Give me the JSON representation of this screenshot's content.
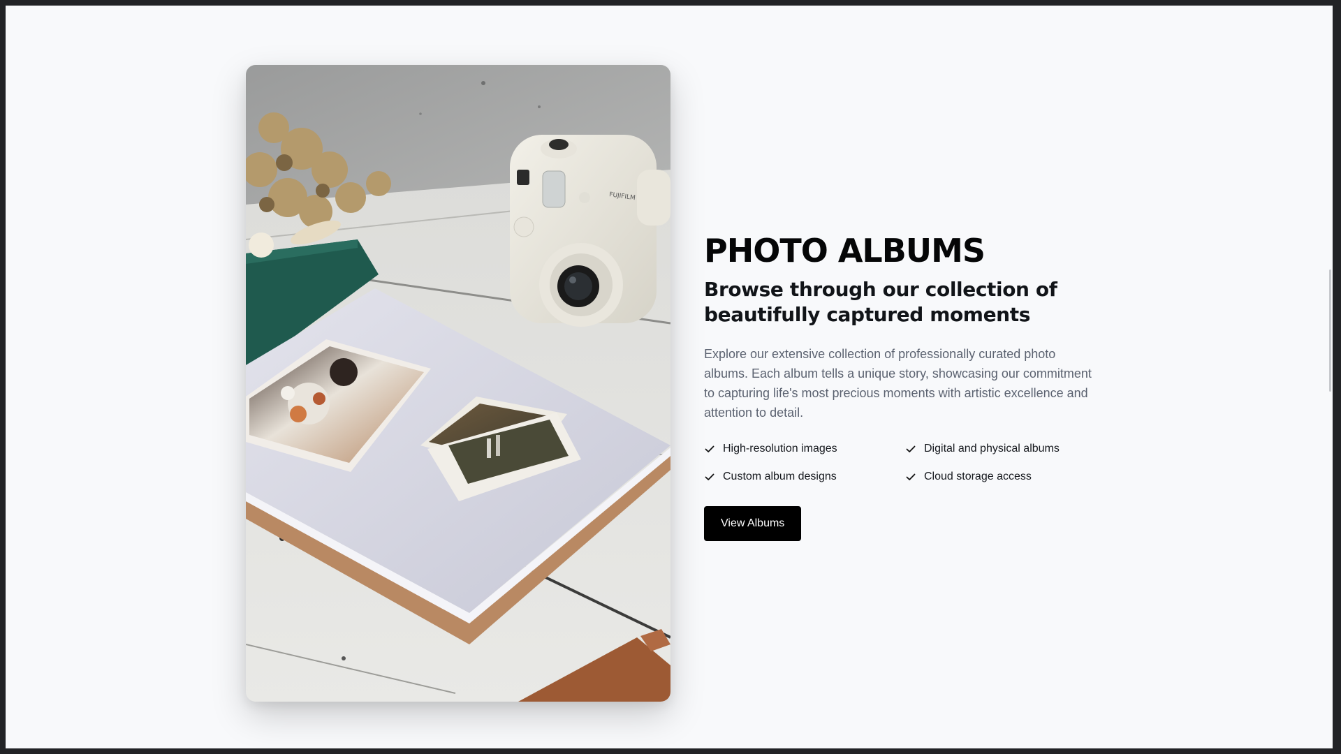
{
  "section": {
    "title": "PHOTO ALBUMS",
    "subtitle": "Browse through our collection of beautifully captured moments",
    "description": "Explore our extensive collection of professionally curated photo albums. Each album tells a unique story, showcasing our commitment to capturing life's most precious moments with artistic excellence and attention to detail.",
    "features": [
      {
        "label": "High-resolution images",
        "icon": "check-icon"
      },
      {
        "label": "Digital and physical albums",
        "icon": "check-icon"
      },
      {
        "label": "Custom album designs",
        "icon": "check-icon"
      },
      {
        "label": "Cloud storage access",
        "icon": "check-icon"
      }
    ],
    "button_label": "View Albums"
  },
  "image": {
    "subject": "photo-album-with-instant-camera",
    "camera_brand": "FUJIFILM"
  },
  "colors": {
    "page_background": "#f8f9fb",
    "button_background": "#000000",
    "button_text": "#ffffff",
    "body_text": "#5b6270",
    "heading_text": "#050607"
  }
}
